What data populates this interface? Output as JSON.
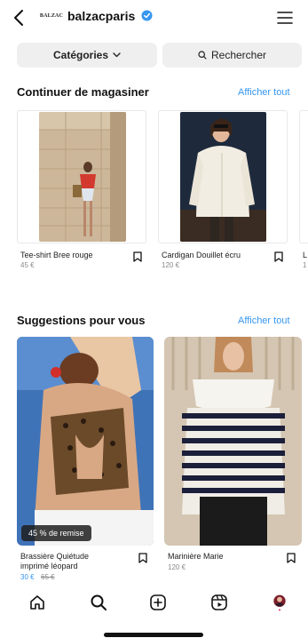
{
  "header": {
    "brand_logo": "BALZAC",
    "brand_name": "balzacparis",
    "verified": true
  },
  "filters": {
    "categories_label": "Catégories",
    "search_label": "Rechercher"
  },
  "continue_section": {
    "title": "Continuer de magasiner",
    "see_all": "Afficher tout",
    "products": [
      {
        "name": "Tee-shirt Bree rouge",
        "price": "45 €"
      },
      {
        "name": "Cardigan Douillet écru",
        "price": "120 €"
      },
      {
        "name": "L",
        "price": "1"
      }
    ]
  },
  "suggestions_section": {
    "title": "Suggestions pour vous",
    "see_all": "Afficher tout",
    "products": [
      {
        "name_line1": "Brassière Quiétude",
        "name_line2": "imprimé léopard",
        "sale_price": "30 €",
        "old_price": "65 €",
        "badge": "45 % de remise"
      },
      {
        "name": "Marinière Marie",
        "price": "120 €"
      }
    ]
  },
  "nav": {
    "items": [
      "home-icon",
      "search-icon",
      "add-icon",
      "reels-icon",
      "profile-avatar"
    ]
  },
  "colors": {
    "accent_blue": "#3797f0",
    "pill_bg": "#efefef"
  }
}
